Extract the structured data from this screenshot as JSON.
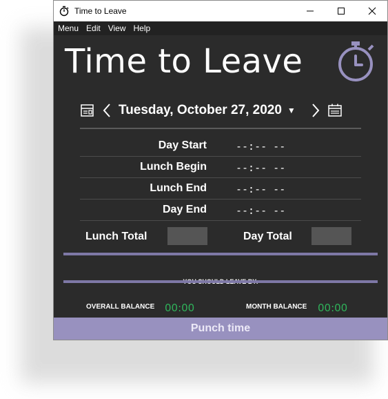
{
  "window": {
    "title": "Time to Leave"
  },
  "menu": [
    "Menu",
    "Edit",
    "View",
    "Help"
  ],
  "header": {
    "title": "Time to Leave"
  },
  "nav": {
    "date": "Tuesday, October 27, 2020",
    "caret": "▼"
  },
  "entries": [
    {
      "label": "Day Start",
      "value": "--:-- --"
    },
    {
      "label": "Lunch Begin",
      "value": "--:-- --"
    },
    {
      "label": "Lunch End",
      "value": "--:-- --"
    },
    {
      "label": "Day End",
      "value": "--:-- --"
    }
  ],
  "totals": {
    "lunch_label": "Lunch Total",
    "day_label": "Day Total"
  },
  "leave_label": "YOU SHOULD LEAVE BY:",
  "balance": {
    "overall_label": "OVERALL BALANCE",
    "overall_value": "00:00",
    "month_label": "MONTH BALANCE",
    "month_value": "00:00"
  },
  "punch_label": "Punch time",
  "colors": {
    "accent": "#9891bf",
    "balance_green": "#2fb25a",
    "background": "#2b2b2b"
  },
  "icons": [
    "stopwatch-icon",
    "minimize-icon",
    "maximize-icon",
    "close-icon",
    "workday-waiver-icon",
    "chevron-left-icon",
    "chevron-right-icon",
    "calendar-icon"
  ]
}
